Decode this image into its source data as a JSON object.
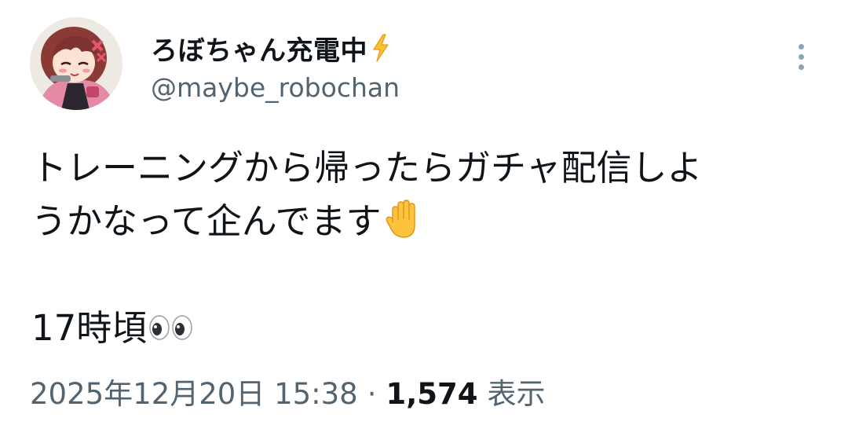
{
  "author": {
    "display_name": "ろぼちゃん充電中",
    "handle": "@maybe_robochan",
    "avatar_icon": "anime-girl-avatar",
    "badge_icon": "lightning-bolt-emoji"
  },
  "tweet": {
    "line1": "トレーニングから帰ったらガチャ配信しよ",
    "line2": "うかなって企んでます",
    "line2_emoji": "raised-hand-emoji",
    "line3": "17時頃",
    "line3_emoji": "eyes-emoji"
  },
  "meta": {
    "timestamp": "2025年12月20日 15:38",
    "separator": "·",
    "views_count": "1,574",
    "views_label": "表示"
  },
  "colors": {
    "text_primary": "#0f1419",
    "text_secondary": "#536471",
    "background": "#ffffff"
  }
}
